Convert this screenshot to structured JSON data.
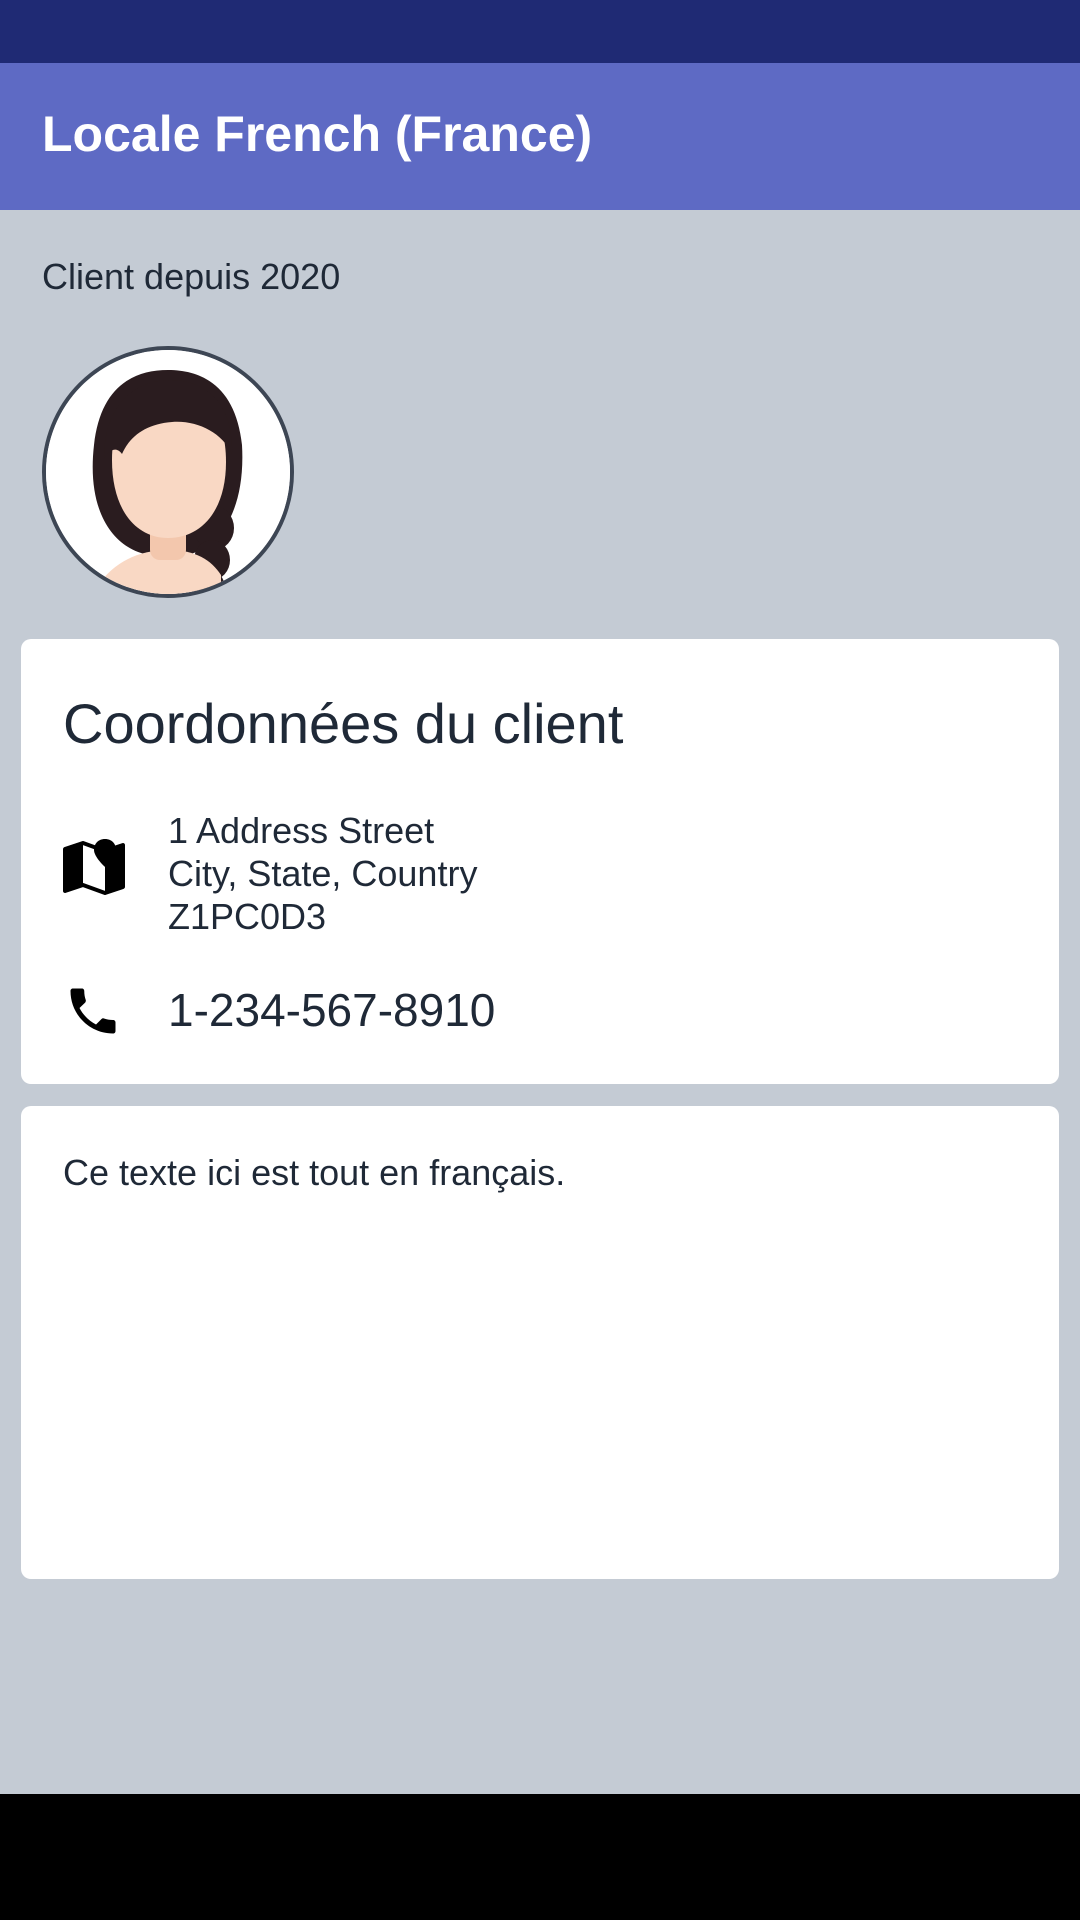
{
  "app_bar": {
    "title": "Locale French (France)"
  },
  "profile": {
    "client_since": "Client depuis 2020",
    "avatar_icon": "woman-avatar"
  },
  "contact_card": {
    "title": "Coordonnées du client",
    "address_icon": "map-icon",
    "address_lines": [
      "1 Address Street",
      "City, State, Country",
      "Z1PC0D3"
    ],
    "phone_icon": "phone-icon",
    "phone": "1-234-567-8910"
  },
  "note_card": {
    "text": "Ce texte ici est tout en français."
  },
  "colors": {
    "status_bar": "#1f2a74",
    "app_bar": "#5e6ac4",
    "background": "#c4cbd4",
    "card": "#ffffff",
    "text": "#1f2937"
  }
}
